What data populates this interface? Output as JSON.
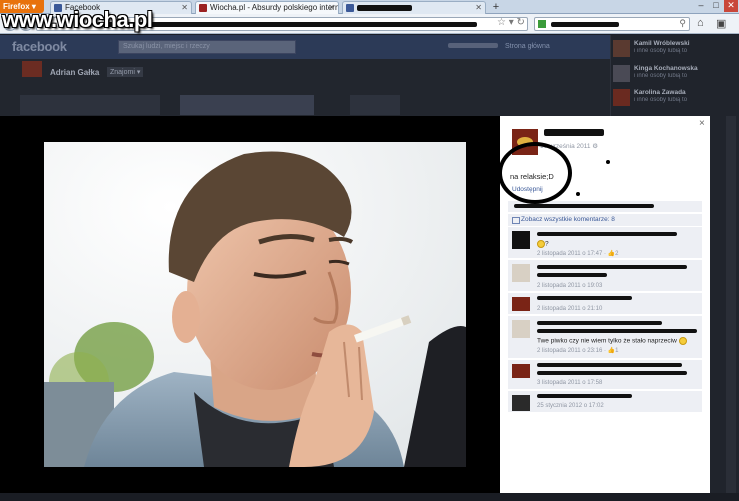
{
  "browser": {
    "app_button": "Firefox",
    "tabs": [
      {
        "label": "Facebook",
        "active": false
      },
      {
        "label": "Wiocha.pl - Absurdy polskiego intern...",
        "active": true
      },
      {
        "label": "",
        "active": false
      }
    ],
    "new_tab": "+",
    "window_controls": {
      "minimize": "–",
      "maximize": "□",
      "close": "✕"
    }
  },
  "watermark": "www.wiocha.pl",
  "facebook": {
    "logo": "facebook",
    "search_placeholder": "Szukaj ludzi, miejsc i rzeczy",
    "top_links": [
      "Strona główna"
    ],
    "profile_name": "Adrian Gałka",
    "friend_badge": "Znajomi",
    "sidebar": [
      {
        "name": "Kamil Wróblewski",
        "text": "i inne osoby lubią to"
      },
      {
        "name": "Kinga Kochanowska",
        "text": "i inne osoby lubią to"
      },
      {
        "name": "Karolina Zawada",
        "text": "i inne osoby lubią to"
      }
    ]
  },
  "photo_panel": {
    "date": "10 września 2011",
    "status": "na relaksie;D",
    "share_label": "Udostępnij",
    "see_all_comments": "Zobacz wszystkie komentarze: 8",
    "close_label": "×",
    "comments": [
      {
        "text": "?",
        "time": "2 listopada 2011 o 17:47",
        "likes": "2"
      },
      {
        "text": "",
        "time": "2 listopada 2011 o 19:03",
        "likes": ""
      },
      {
        "text": "",
        "time": "2 listopada 2011 o 21:10",
        "likes": ""
      },
      {
        "text": "Twe piwko czy nie  wiem tylko że stało naprzeciw ",
        "time": "2 listopada 2011 o 23:16",
        "likes": "1"
      },
      {
        "text": "",
        "time": "3 listopada 2011 o 17:58",
        "likes": ""
      },
      {
        "text": "",
        "time": "25 stycznia 2012 o 17:02",
        "likes": ""
      }
    ]
  },
  "colors": {
    "facebook_blue": "#3b5998",
    "firefox_orange": "#e8720c",
    "theater_black": "#000000"
  }
}
